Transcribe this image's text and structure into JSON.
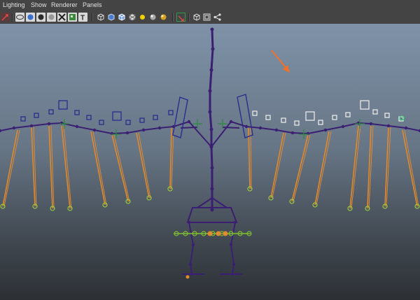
{
  "menu": {
    "items": [
      {
        "name": "lighting",
        "label": "Lighting"
      },
      {
        "name": "show",
        "label": "Show"
      },
      {
        "name": "renderer",
        "label": "Renderer"
      },
      {
        "name": "panels",
        "label": "Panels"
      }
    ]
  },
  "toolbar": {
    "icons": [
      "magnet-arrow-icon",
      "wireframe-icon",
      "smooth-shade-icon",
      "smooth-shade-all-icon",
      "bounding-box-icon",
      "textured-icon",
      "use-lights-icon",
      "text-icon",
      "cube-icon",
      "shaded-cube-icon",
      "wireframe-on-shaded-icon",
      "default-light-icon",
      "all-lights-icon",
      "shadows-icon",
      "isolate-select-icon",
      "xray-icon",
      "xray-joints-icon",
      "hypergraph-icon"
    ]
  },
  "viewport": {
    "annotation": "orange arrow",
    "colors": {
      "bones": "#3a1f72",
      "ik_chains": "#e08a30",
      "controls_left": "#2c2c8c",
      "controls_right": "#e8e8e8",
      "locators": "#7fbf2f",
      "pivots": "#2a8a3c",
      "arrow": "#f07028"
    }
  }
}
